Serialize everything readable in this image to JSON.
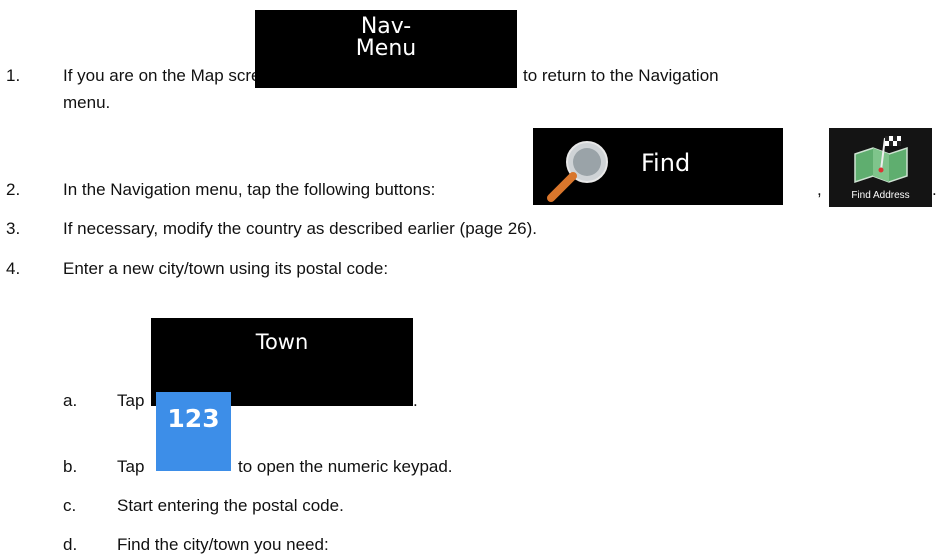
{
  "steps": [
    {
      "num": "1.",
      "text_before": "If you are on the Map screen, tap",
      "text_after": "to return to the Navigation",
      "text_cont": "menu."
    },
    {
      "num": "2.",
      "text_before": "In the Navigation menu, tap the following buttons:",
      "sep": ",",
      "end": "."
    },
    {
      "num": "3.",
      "text": "If necessary, modify the country as described earlier (page 26)."
    },
    {
      "num": "4.",
      "text": "Enter a new city/town using its postal code:"
    }
  ],
  "substeps": [
    {
      "letter": "a.",
      "text_before": "Tap",
      "end": "."
    },
    {
      "letter": "b.",
      "text_before": "Tap",
      "text_after": "to open the numeric keypad."
    },
    {
      "letter": "c.",
      "text": "Start entering the postal code."
    },
    {
      "letter": "d.",
      "text": "Find the city/town you need:"
    }
  ],
  "buttons": {
    "nav_menu_line1": "Nav-",
    "nav_menu_line2": "Menu",
    "find": "Find",
    "find_address": "Find Address",
    "town": "Town",
    "numeric": "123"
  },
  "icons": {
    "find": "magnifier-icon",
    "find_address": "map-with-flag-icon"
  },
  "colors": {
    "button_bg": "#000000",
    "numeric_bg": "#3d8ee8"
  }
}
